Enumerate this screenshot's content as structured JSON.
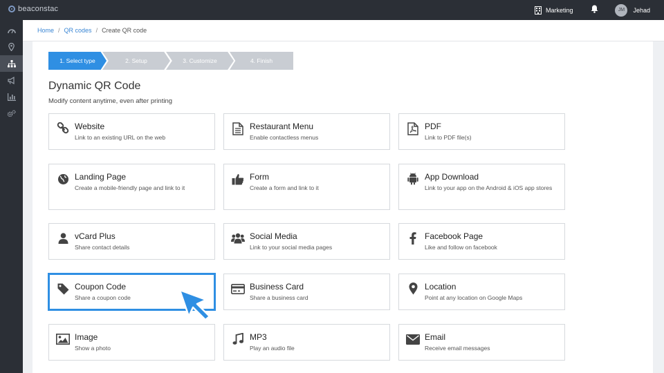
{
  "topbar": {
    "logo_text": "beaconstac",
    "org_label": "Marketing",
    "user_initials": "JM",
    "user_name": "Jehad"
  },
  "sidebar": {
    "items": [
      {
        "icon": "dashboard-icon",
        "active": false
      },
      {
        "icon": "location-pin-icon",
        "active": false
      },
      {
        "icon": "sitemap-icon",
        "active": true
      },
      {
        "icon": "megaphone-icon",
        "active": false
      },
      {
        "icon": "analytics-icon",
        "active": false
      },
      {
        "icon": "settings-cogs-icon",
        "active": false
      }
    ]
  },
  "breadcrumb": {
    "home": "Home",
    "qr_codes": "QR codes",
    "current": "Create QR code"
  },
  "steps": [
    {
      "label": "1. Select type",
      "active": true
    },
    {
      "label": "2. Setup",
      "active": false
    },
    {
      "label": "3. Customize",
      "active": false
    },
    {
      "label": "4. Finish",
      "active": false
    }
  ],
  "main": {
    "title": "Dynamic QR Code",
    "subtitle": "Modify content anytime, even after printing"
  },
  "cards": [
    {
      "title": "Website",
      "desc": "Link to an existing URL on the web",
      "icon": "link-icon"
    },
    {
      "title": "Restaurant Menu",
      "desc": "Enable contactless menus",
      "icon": "document-icon"
    },
    {
      "title": "PDF",
      "desc": "Link to PDF file(s)",
      "icon": "pdf-file-icon"
    },
    {
      "title": "Landing Page",
      "desc": "Create a mobile-friendly page and link to it",
      "icon": "globe-icon"
    },
    {
      "title": "Form",
      "desc": "Create a form and link to it",
      "icon": "thumbs-up-icon"
    },
    {
      "title": "App Download",
      "desc": "Link to your app on the Android & iOS app stores",
      "icon": "android-icon"
    },
    {
      "title": "vCard Plus",
      "desc": "Share contact details",
      "icon": "user-icon"
    },
    {
      "title": "Social Media",
      "desc": "Link to your social media pages",
      "icon": "users-icon"
    },
    {
      "title": "Facebook Page",
      "desc": "Like and follow on facebook",
      "icon": "facebook-icon"
    },
    {
      "title": "Coupon Code",
      "desc": "Share a coupon code",
      "icon": "tag-icon",
      "selected": true
    },
    {
      "title": "Business Card",
      "desc": "Share a business card",
      "icon": "business-card-icon"
    },
    {
      "title": "Location",
      "desc": "Point at any location on Google Maps",
      "icon": "map-marker-icon"
    },
    {
      "title": "Image",
      "desc": "Show a photo",
      "icon": "image-icon"
    },
    {
      "title": "MP3",
      "desc": "Play an audio file",
      "icon": "music-icon"
    },
    {
      "title": "Email",
      "desc": "Receive email messages",
      "icon": "envelope-icon"
    }
  ],
  "colors": {
    "accent": "#2f8fe3",
    "sidebar_bg": "#2b2f36",
    "step_inactive": "#c9cdd3"
  }
}
